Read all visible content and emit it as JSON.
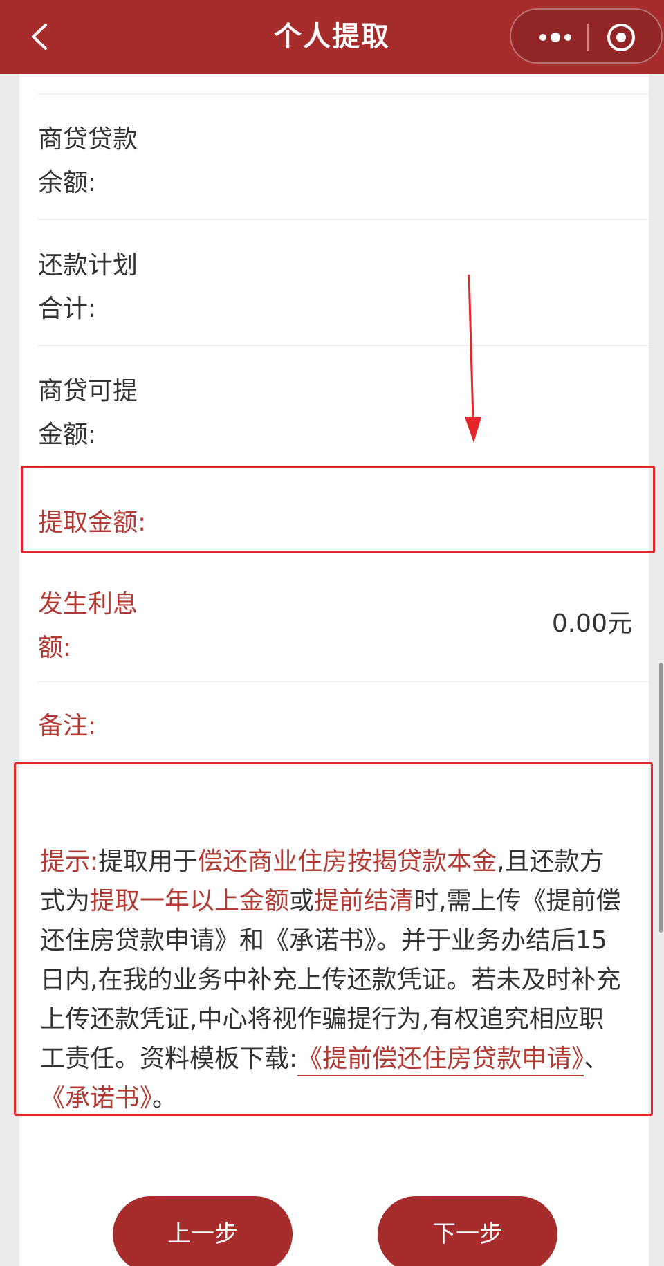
{
  "navbar": {
    "title": "个人提取"
  },
  "form": {
    "loan_balance_label": [
      "商贷贷款",
      "余额:"
    ],
    "repay_plan_total_label": [
      "还款计划",
      "合计:"
    ],
    "extractable_label": [
      "商贷可提",
      "金额:"
    ],
    "extract_amount_label": "提取金额:",
    "interest_label": [
      "发生利息",
      "额:"
    ],
    "interest_value": "0.00元",
    "remark_label": "备注:"
  },
  "notice": {
    "prefix": "提示:",
    "t1": "提取用于",
    "h1": "偿还商业住房按揭贷款本金",
    "t2": ",且还款方式为",
    "h2": "提取一年以上金额",
    "t3": "或",
    "h3": "提前结清",
    "t4": "时,需上传《提前偿还住房贷款申请》和《承诺书》。并于业务办结后15日内,在我的业务中补充上传还款凭证。若未及时补充上传还款凭证,中心将视作骗提行为,有权追究相应职工责任。资料模板下载:",
    "link1": "《提前偿还住房贷款申请》",
    "sep": "、",
    "link2": "《承诺书》",
    "end": "。"
  },
  "buttons": {
    "prev": "上一步",
    "next": "下一步"
  },
  "colors": {
    "brand": "#a72c2c",
    "label_red": "#b33a33",
    "annotation_red": "#e4262a"
  },
  "icons": [
    "back-icon",
    "more-icon",
    "close-icon",
    "arrow-down-annotation"
  ]
}
